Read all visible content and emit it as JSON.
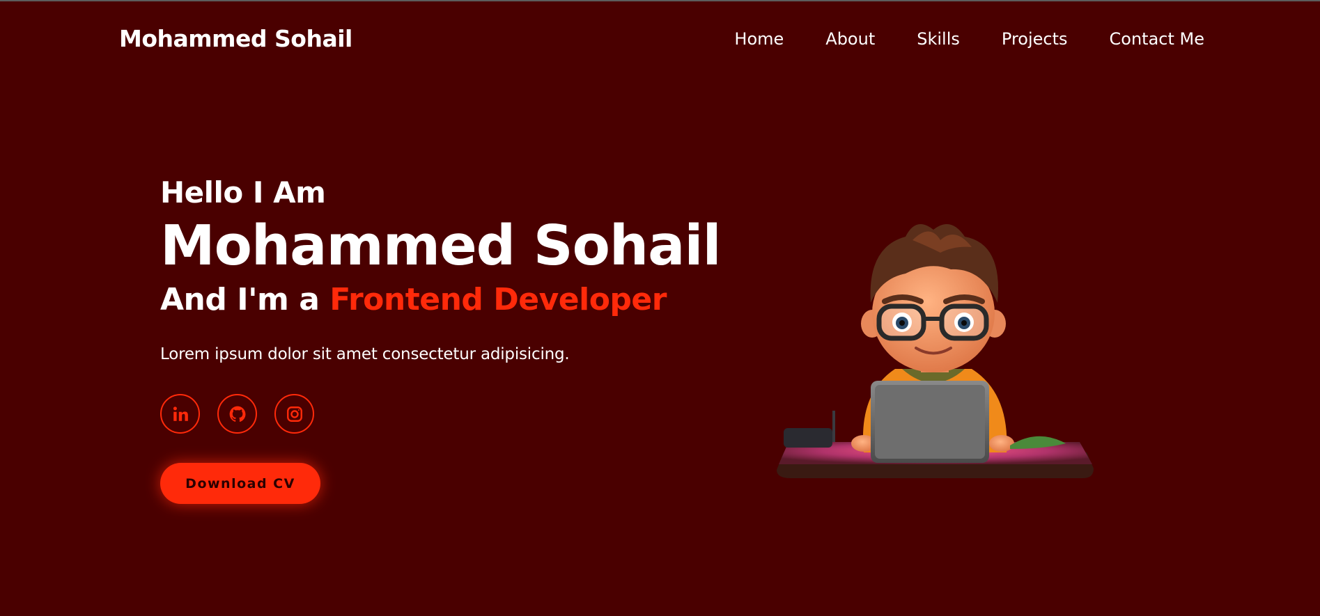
{
  "nav": {
    "brand": "Mohammed Sohail",
    "links": [
      "Home",
      "About",
      "Skills",
      "Projects",
      "Contact Me"
    ]
  },
  "hero": {
    "greeting": "Hello I Am",
    "name": "Mohammed Sohail",
    "role_prefix": "And I'm a ",
    "role": "Frontend Developer",
    "description": "Lorem ipsum dolor sit amet consectetur adipisicing.",
    "download_label": "Download CV"
  },
  "socials": [
    {
      "name": "linkedin",
      "icon": "linkedin-icon"
    },
    {
      "name": "github",
      "icon": "github-icon"
    },
    {
      "name": "instagram",
      "icon": "instagram-icon"
    }
  ],
  "colors": {
    "background": "#4a0000",
    "accent": "#ff2a0a",
    "text": "#ffffff"
  }
}
